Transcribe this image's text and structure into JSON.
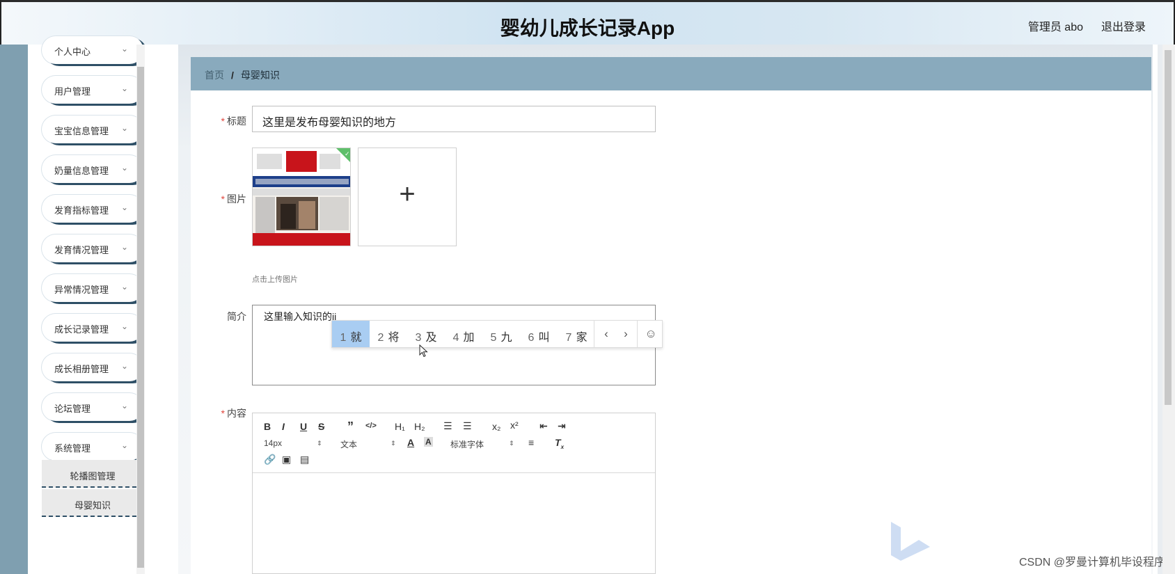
{
  "header": {
    "title": "婴幼儿成长记录App",
    "user": "管理员 abo",
    "logout": "退出登录"
  },
  "sidebar": {
    "items": [
      {
        "label": "个人中心"
      },
      {
        "label": "用户管理"
      },
      {
        "label": "宝宝信息管理"
      },
      {
        "label": "奶量信息管理"
      },
      {
        "label": "发育指标管理"
      },
      {
        "label": "发育情况管理"
      },
      {
        "label": "异常情况管理"
      },
      {
        "label": "成长记录管理"
      },
      {
        "label": "成长相册管理"
      },
      {
        "label": "论坛管理"
      },
      {
        "label": "系统管理"
      }
    ],
    "submenu": [
      {
        "label": "轮播图管理"
      },
      {
        "label": "母婴知识"
      }
    ]
  },
  "breadcrumb": {
    "home": "首页",
    "separator": "/",
    "current": "母婴知识"
  },
  "form": {
    "title_label": "标题",
    "title_value": "这里是发布母婴知识的地方",
    "image_label": "图片",
    "upload_tip": "点击上传图片",
    "intro_label": "简介",
    "intro_value": "这里输入知识的jj",
    "content_label": "内容",
    "required_mark": "*"
  },
  "ime": {
    "candidates": [
      {
        "num": "1",
        "word": "就"
      },
      {
        "num": "2",
        "word": "将"
      },
      {
        "num": "3",
        "word": "及"
      },
      {
        "num": "4",
        "word": "加"
      },
      {
        "num": "5",
        "word": "九"
      },
      {
        "num": "6",
        "word": "叫"
      },
      {
        "num": "7",
        "word": "家"
      }
    ],
    "prev": "‹",
    "next": "›",
    "emoji": "☺"
  },
  "editor": {
    "font_size": "14px",
    "format": "文本",
    "font_family": "标准字体"
  },
  "watermark": "CSDN @罗曼计算机毕设程序",
  "colors": {
    "breadcrumb_bg": "#89aabd",
    "sidebar_strip": "#7f9fb0",
    "menu_shadow": "#2e4f66",
    "ime_selected": "#a9cdf2",
    "required": "#e0453c"
  }
}
